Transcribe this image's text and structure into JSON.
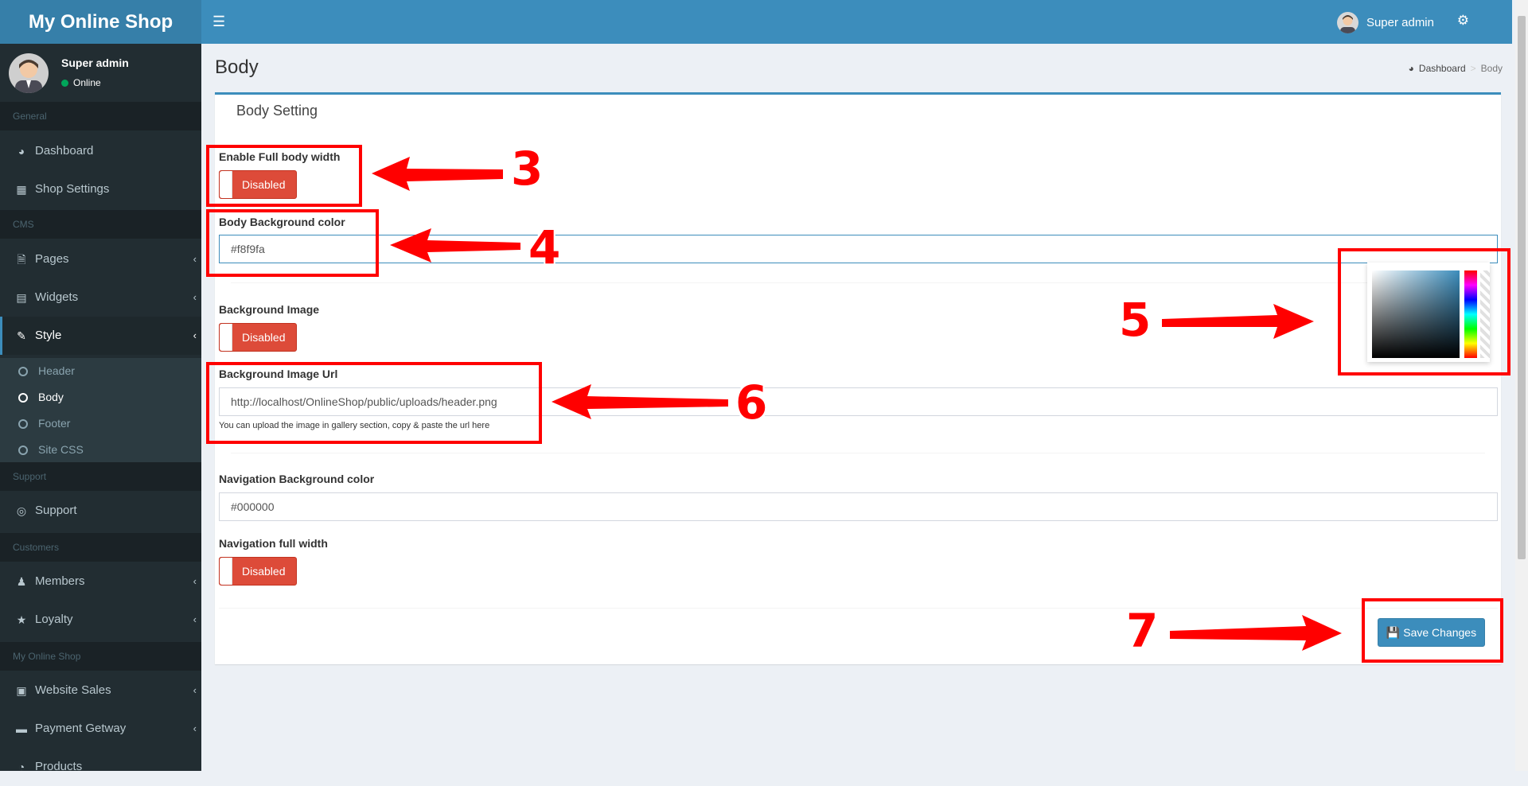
{
  "app": {
    "logo": "My Online Shop"
  },
  "topbar": {
    "user_name": "Super admin"
  },
  "sidebar": {
    "user": {
      "name": "Super admin",
      "status": "Online"
    },
    "sections": [
      "General",
      "CMS",
      "Support",
      "Customers",
      "My Online Shop"
    ],
    "items": [
      {
        "label": "Dashboard",
        "icon": "dashboard-icon"
      },
      {
        "label": "Shop Settings",
        "icon": "building-icon"
      },
      {
        "label": "Pages",
        "icon": "file-icon"
      },
      {
        "label": "Widgets",
        "icon": "widget-icon"
      },
      {
        "label": "Style",
        "icon": "paint-brush-icon"
      },
      {
        "label": "Support",
        "icon": "life-ring-icon"
      },
      {
        "label": "Members",
        "icon": "users-icon"
      },
      {
        "label": "Loyalty",
        "icon": "trophy-icon"
      },
      {
        "label": "Website Sales",
        "icon": "money-icon"
      },
      {
        "label": "Payment Getway",
        "icon": "credit-card-icon"
      },
      {
        "label": "Products",
        "icon": "pie-chart-icon"
      }
    ],
    "style_submenu": [
      "Header",
      "Body",
      "Footer",
      "Site CSS"
    ]
  },
  "page": {
    "title": "Body",
    "breadcrumb": [
      "Dashboard",
      "Body"
    ],
    "box_title": "Body Setting"
  },
  "form": {
    "full_width": {
      "label": "Enable Full body width",
      "state": "Disabled"
    },
    "bg_color": {
      "label": "Body Background color",
      "value": "#f8f9fa"
    },
    "bg_image": {
      "label": "Background Image",
      "state": "Disabled"
    },
    "bg_image_url": {
      "label": "Background Image Url",
      "value": "http://localhost/OnlineShop/public/uploads/header.png",
      "help": "You can upload the image in gallery section, copy & paste the url here"
    },
    "nav_color": {
      "label": "Navigation Background color",
      "value": "#000000"
    },
    "nav_full_width": {
      "label": "Navigation full width",
      "state": "Disabled"
    },
    "save_label": "Save Changes"
  },
  "annotations": [
    "3",
    "4",
    "5",
    "6",
    "7"
  ],
  "colors": {
    "primary": "#3c8dbc",
    "danger": "#dd4b39",
    "sidebar": "#222d32",
    "annotation": "#ff0000"
  }
}
